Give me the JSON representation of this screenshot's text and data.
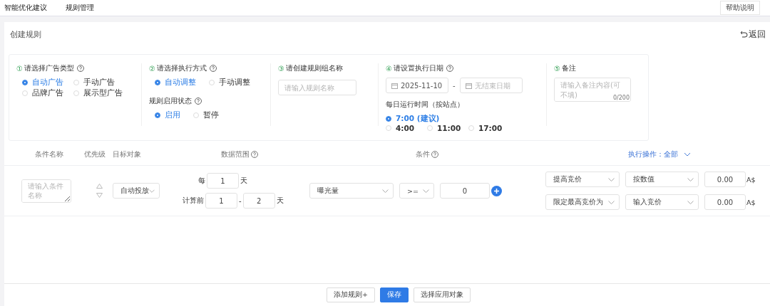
{
  "nav": {
    "tabs": [
      {
        "label": "智能优化建议"
      },
      {
        "label": "规则管理"
      }
    ],
    "help_button": "帮助说明"
  },
  "page": {
    "title": "创建规则",
    "back": "返回"
  },
  "form": {
    "ad_type": {
      "num": "①",
      "label": "请选择广告类型",
      "help": true,
      "options": [
        {
          "label": "自动广告",
          "selected": true
        },
        {
          "label": "手动广告",
          "selected": false
        },
        {
          "label": "品牌广告",
          "selected": false
        },
        {
          "label": "展示型广告",
          "selected": false
        }
      ]
    },
    "exec_mode": {
      "num": "②",
      "label": "请选择执行方式",
      "help": true,
      "options": [
        {
          "label": "自动调整",
          "selected": true
        },
        {
          "label": "手动调整",
          "selected": false
        }
      ]
    },
    "rule_status": {
      "label": "规则启用状态",
      "help": true,
      "options": [
        {
          "label": "启用",
          "selected": true
        },
        {
          "label": "暂停",
          "selected": false
        }
      ]
    },
    "group_name": {
      "num": "③",
      "label": "请创建规则组名称",
      "placeholder": "请输入规则名称"
    },
    "exec_date": {
      "num": "④",
      "label": "请设置执行日期",
      "help": true,
      "start": "2025-11-10",
      "separator": "-",
      "end_placeholder": "无结束日期"
    },
    "run_time": {
      "label": "每日运行时间（按站点）",
      "options": [
        {
          "label": "7:00 (建议)",
          "selected": true
        },
        {
          "label": "4:00",
          "selected": false
        },
        {
          "label": "11:00",
          "selected": false
        },
        {
          "label": "17:00",
          "selected": false
        }
      ]
    },
    "note": {
      "num": "⑤",
      "label": "备注",
      "placeholder": "请输入备注内容(可不填)",
      "counter": "0/200"
    }
  },
  "conditions": {
    "columns": [
      {
        "label": "条件名称",
        "help": false
      },
      {
        "label": "优先级",
        "help": false
      },
      {
        "label": "目标对象",
        "help": false
      },
      {
        "label": "数据范围",
        "help": true
      },
      {
        "label": "条件",
        "help": true
      }
    ],
    "action_header": "执行操作：全部",
    "row": {
      "name_placeholder": "请输入条件名称",
      "target": "自动投放",
      "every_label": "每",
      "every_value": "1",
      "every_unit": "天",
      "calc_label": "计算前",
      "calc_from": "1",
      "calc_sep": "-",
      "calc_to": "2",
      "calc_unit": "天",
      "metric": "曝光量",
      "operator": ">=",
      "threshold": "0",
      "actions": [
        {
          "type": "提高竞价",
          "mode": "按数值",
          "value": "0.00",
          "unit": "A$"
        },
        {
          "type": "限定最高竞价为",
          "mode": "输入竞价",
          "value": "0.00",
          "unit": "A$"
        }
      ]
    }
  },
  "footer": {
    "buttons": [
      {
        "label": "添加规则+",
        "primary": false
      },
      {
        "label": "保存",
        "primary": true
      },
      {
        "label": "选择应用对象",
        "primary": false
      }
    ]
  }
}
